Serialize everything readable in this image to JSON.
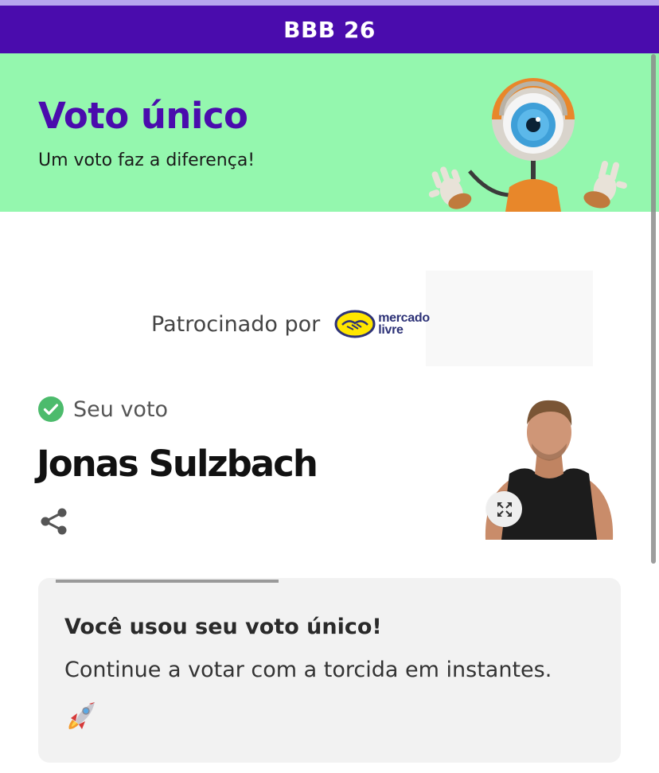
{
  "topbar": {
    "title": "BBB 26"
  },
  "hero": {
    "title": "Voto único",
    "subtitle": "Um voto faz a diferença!",
    "mascot_icon": "bbb-eye-mascot-icon"
  },
  "sponsor": {
    "label": "Patrocinado por",
    "brand_line1": "mercado",
    "brand_line2": "livre",
    "logo_icon": "handshake-icon"
  },
  "vote": {
    "status_label": "Seu voto",
    "status_icon": "check-circle-icon",
    "candidate_name": "Jonas Sulzbach",
    "share_icon": "share-icon",
    "expand_icon": "expand-icon"
  },
  "notice": {
    "title": "Você usou seu voto único!",
    "text": "Continue a votar com a torcida em instantes.",
    "emoji_icon": "rocket-icon"
  },
  "colors": {
    "brand_purple": "#4a0cad",
    "hero_green": "#94f7ae",
    "check_green": "#4cbb6c",
    "notice_bg": "#f2f2f2"
  }
}
